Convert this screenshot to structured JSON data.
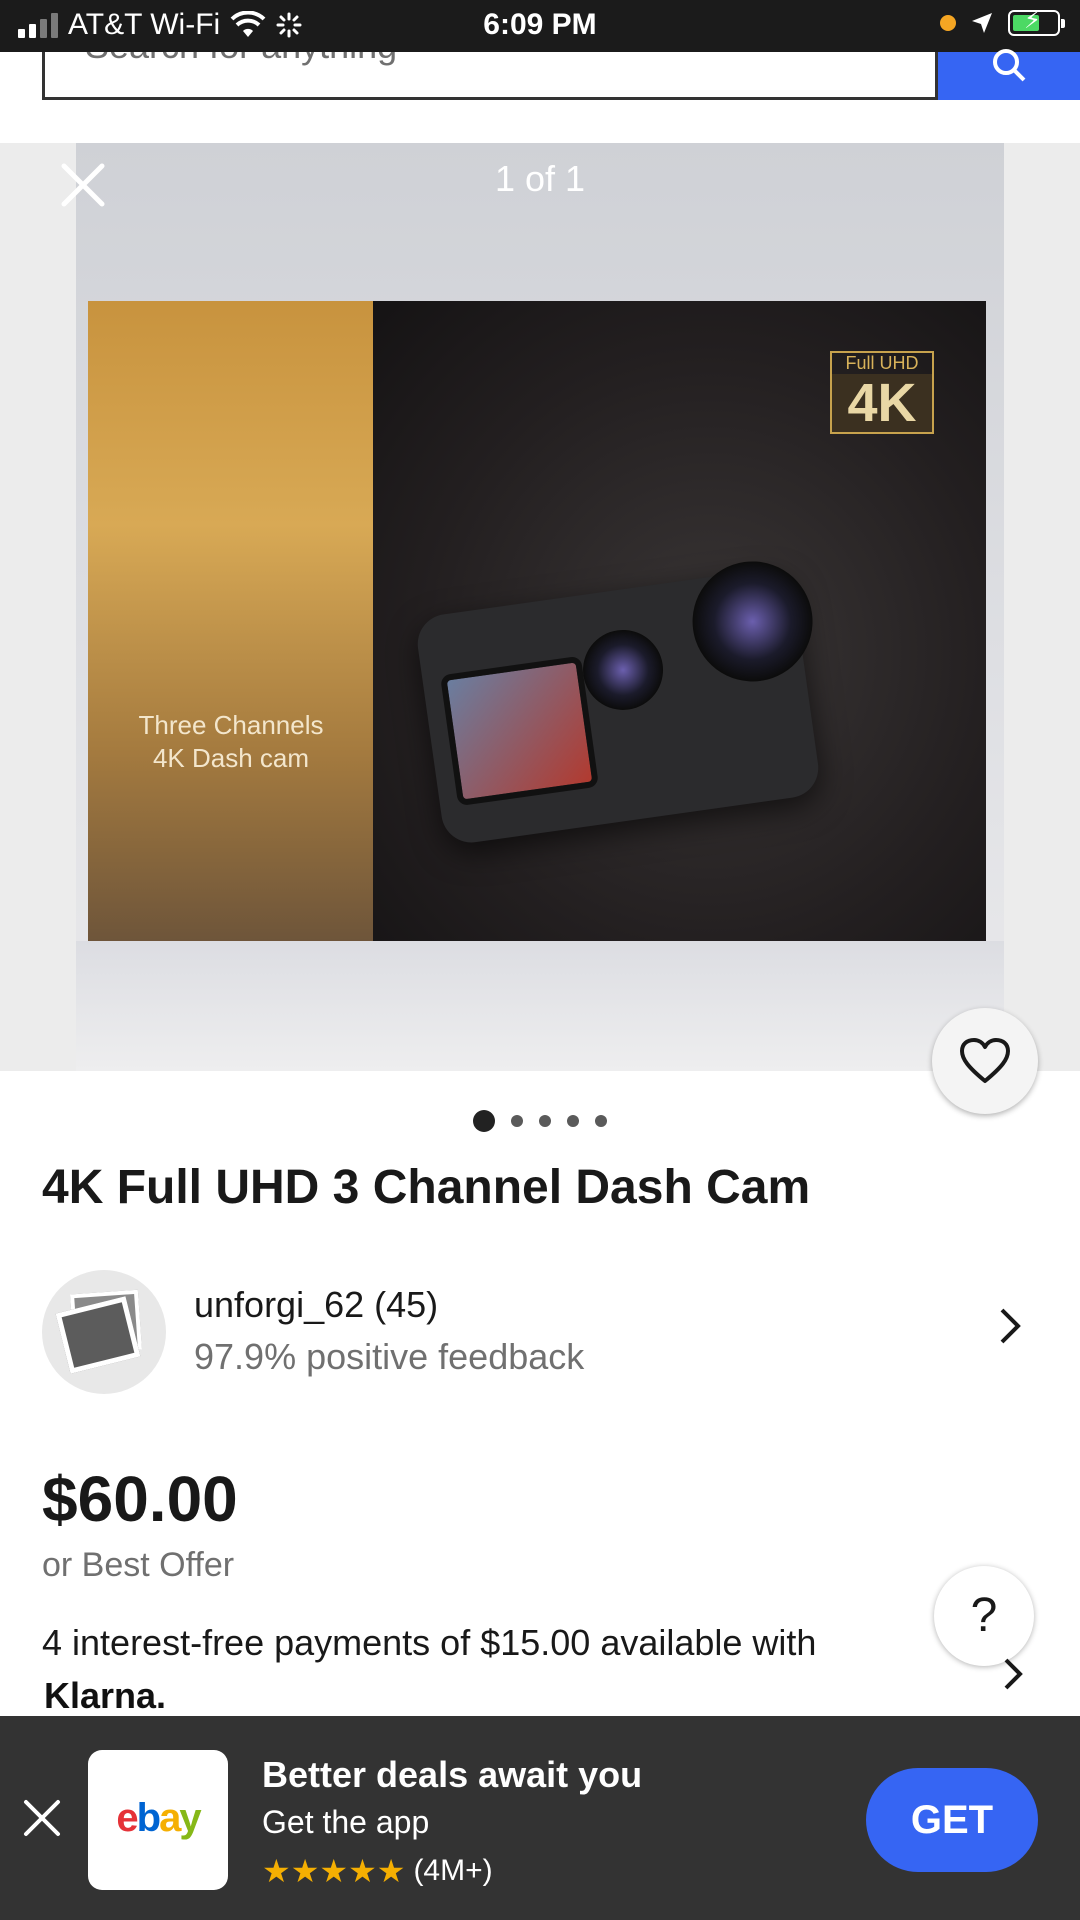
{
  "status_bar": {
    "carrier": "AT&T Wi-Fi",
    "time": "6:09 PM"
  },
  "search": {
    "placeholder": "Search for anything"
  },
  "viewer": {
    "counter": "1 of 1",
    "image_alt_text": {
      "side_panel": "Three Channels\n4K Dash cam",
      "badge_top": "Full UHD",
      "badge_big": "4K"
    },
    "dots_count": 5,
    "active_dot": 0
  },
  "listing": {
    "title": "4K Full UHD 3 Channel Dash Cam",
    "seller": {
      "name": "unforgi_62 (45)",
      "feedback": "97.9% positive feedback"
    },
    "price": "$60.00",
    "offer": "or Best Offer",
    "payments_text": "4 interest-free payments of $15.00 available with",
    "payments_provider": "Klarna."
  },
  "help": {
    "label": "?"
  },
  "app_banner": {
    "logo_text": "ebay",
    "logo_colors": [
      "#e53238",
      "#0064d2",
      "#f5af02",
      "#86b817"
    ],
    "title": "Better deals await you",
    "subtitle": "Get the app",
    "stars": "★★★★★",
    "rating_count": "(4M+)",
    "get_label": "GET"
  },
  "colors": {
    "accent_blue": "#3665f3",
    "banner_bg": "#333333",
    "star_gold": "#f5af02"
  }
}
